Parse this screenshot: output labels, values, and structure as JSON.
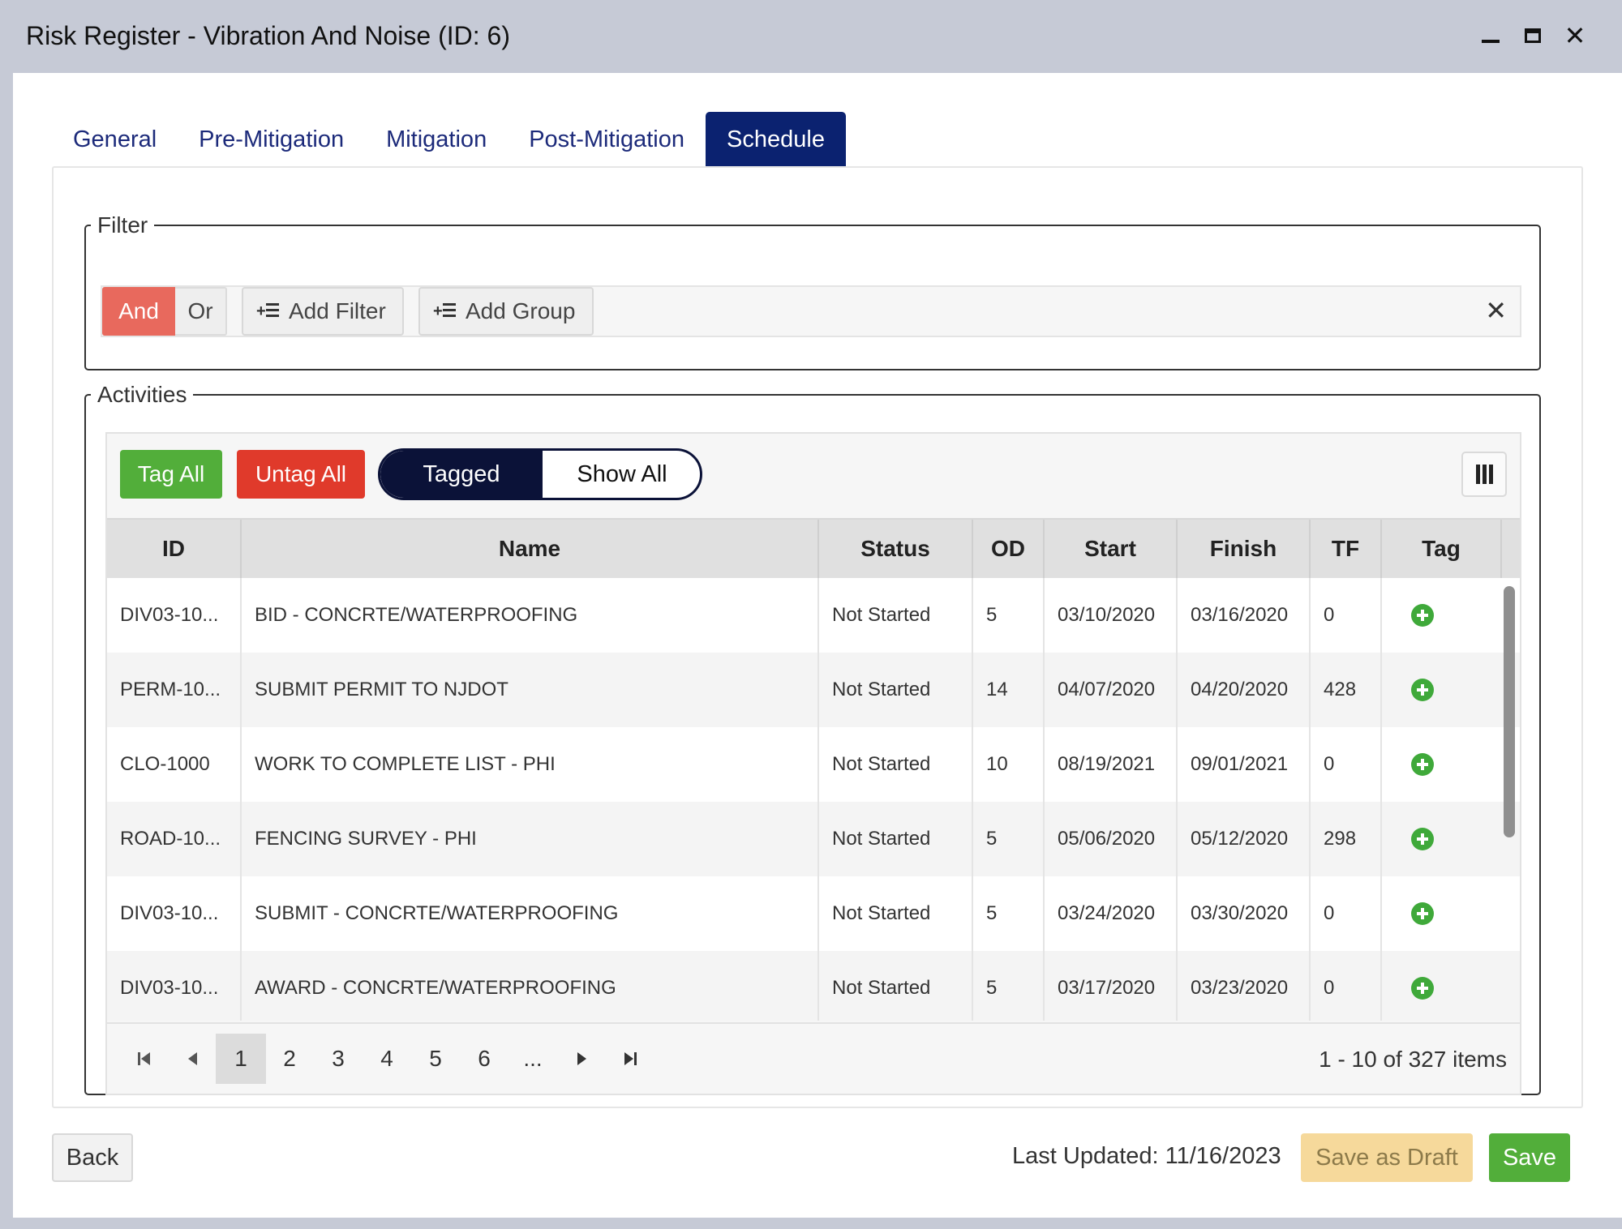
{
  "window": {
    "title": "Risk Register - Vibration And Noise (ID: 6)",
    "close_glyph": "✕"
  },
  "tabs": [
    {
      "label": "General",
      "active": false
    },
    {
      "label": "Pre-Mitigation",
      "active": false
    },
    {
      "label": "Mitigation",
      "active": false
    },
    {
      "label": "Post-Mitigation",
      "active": false
    },
    {
      "label": "Schedule",
      "active": true
    }
  ],
  "filter": {
    "legend": "Filter",
    "and_label": "And",
    "or_label": "Or",
    "add_filter_label": "Add Filter",
    "add_group_label": "Add Group",
    "clear_glyph": "✕"
  },
  "activities": {
    "legend": "Activities",
    "tag_all_label": "Tag All",
    "untag_all_label": "Untag All",
    "toggle_tagged_label": "Tagged",
    "toggle_show_all_label": "Show All",
    "toggle_selected": "Tagged",
    "columns": [
      "ID",
      "Name",
      "Status",
      "OD",
      "Start",
      "Finish",
      "TF",
      "Tag"
    ],
    "rows": [
      {
        "id": "DIV03-10...",
        "name": "BID - CONCRTE/WATERPROOFING",
        "status": "Not Started",
        "od": "5",
        "start": "03/10/2020",
        "finish": "03/16/2020",
        "tf": "0"
      },
      {
        "id": "PERM-10...",
        "name": "SUBMIT PERMIT TO NJDOT",
        "status": "Not Started",
        "od": "14",
        "start": "04/07/2020",
        "finish": "04/20/2020",
        "tf": "428"
      },
      {
        "id": "CLO-1000",
        "name": "WORK TO COMPLETE LIST - PHI",
        "status": "Not Started",
        "od": "10",
        "start": "08/19/2021",
        "finish": "09/01/2021",
        "tf": "0"
      },
      {
        "id": "ROAD-10...",
        "name": "FENCING SURVEY - PHI",
        "status": "Not Started",
        "od": "5",
        "start": "05/06/2020",
        "finish": "05/12/2020",
        "tf": "298"
      },
      {
        "id": "DIV03-10...",
        "name": "SUBMIT - CONCRTE/WATERPROOFING",
        "status": "Not Started",
        "od": "5",
        "start": "03/24/2020",
        "finish": "03/30/2020",
        "tf": "0"
      },
      {
        "id": "DIV03-10...",
        "name": "AWARD - CONCRTE/WATERPROOFING",
        "status": "Not Started",
        "od": "5",
        "start": "03/17/2020",
        "finish": "03/23/2020",
        "tf": "0"
      }
    ],
    "pager": {
      "pages": [
        "1",
        "2",
        "3",
        "4",
        "5",
        "6",
        "..."
      ],
      "current_page": "1",
      "info": "1 - 10 of 327 items"
    }
  },
  "footer": {
    "back_label": "Back",
    "last_updated": "Last Updated: 11/16/2023",
    "save_draft_label": "Save as Draft",
    "save_label": "Save"
  },
  "colors": {
    "tab_active": "#0b2270",
    "and_active": "#e8695d",
    "tag_all": "#52ae3a",
    "untag_all": "#e03a2b",
    "toggle_dark": "#0b1238",
    "save_draft": "#f6d99b",
    "save": "#52ae3a"
  },
  "icons": {
    "minimize": "minimize-icon",
    "maximize": "maximize-icon",
    "close": "close-icon",
    "add_filter": "add-filter-icon",
    "add_group": "add-group-icon",
    "columns": "columns-icon",
    "add_tag": "plus-circle-icon"
  }
}
